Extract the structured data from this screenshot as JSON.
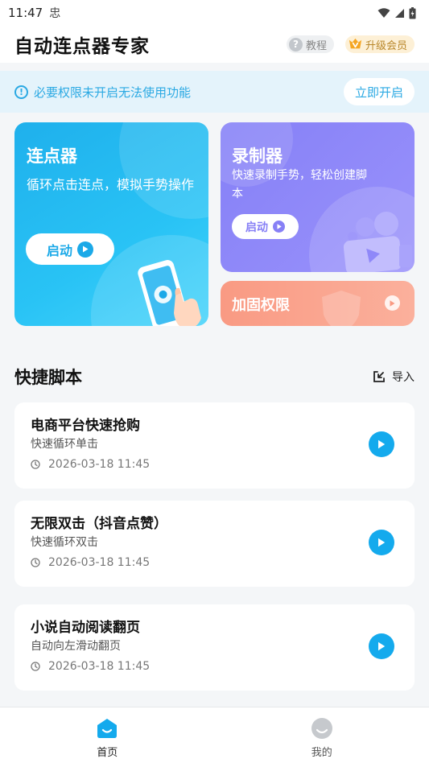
{
  "status_bar": {
    "time": "11:47",
    "notification": "忠"
  },
  "header": {
    "title": "自动连点器专家",
    "tutorial_label": "教程",
    "vip_label": "升级会员"
  },
  "alert": {
    "text": "必要权限未开启无法使用功能",
    "button": "立即开启"
  },
  "cards": {
    "clicker": {
      "title": "连点器",
      "desc": "循环点击连点，模拟手势操作",
      "button": "启动"
    },
    "recorder": {
      "title": "录制器",
      "desc": "快速录制手势，轻松创建脚本",
      "button": "启动"
    },
    "reinforce": {
      "title": "加固权限"
    }
  },
  "scripts": {
    "title": "快捷脚本",
    "import_label": "导入",
    "items": [
      {
        "name": "电商平台快速抢购",
        "desc": "快速循环单击",
        "time": "2026-03-18 11:45"
      },
      {
        "name": "无限双击（抖音点赞）",
        "desc": "快速循环双击",
        "time": "2026-03-18 11:45"
      },
      {
        "name": "小说自动阅读翻页",
        "desc": "自动向左滑动翻页",
        "time": "2026-03-18 11:45"
      }
    ]
  },
  "tabbar": {
    "home_label": "首页",
    "mine_label": "我的"
  },
  "colors": {
    "accent": "#14aaed",
    "alert_bg": "#e4f3fb",
    "clicker": "#29c3f5",
    "recorder": "#8f88f9",
    "reinforce": "#fba28d",
    "vip": "#f5a623"
  },
  "icons": {
    "tutorial": "question-icon",
    "vip": "vip-crown-icon",
    "alert": "info-icon",
    "play": "play-icon",
    "clock": "clock-icon",
    "import": "import-icon",
    "home": "home-icon",
    "mine": "profile-icon"
  }
}
